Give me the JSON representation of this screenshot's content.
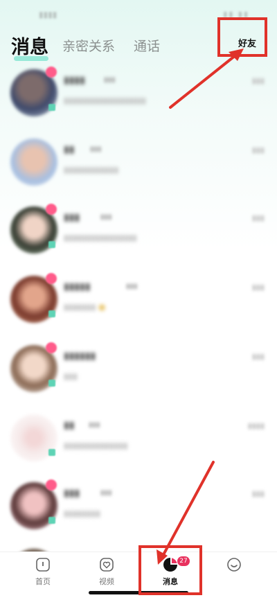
{
  "header": {
    "tabs": [
      {
        "label": "消息",
        "active": true
      },
      {
        "label": "亲密关系",
        "active": false
      },
      {
        "label": "通话",
        "active": false
      }
    ],
    "friends_label": "好友"
  },
  "bottom_nav": {
    "items": [
      {
        "label": "首页",
        "icon": "home-icon"
      },
      {
        "label": "视频",
        "icon": "heart-icon"
      },
      {
        "label": "消息",
        "icon": "message-icon",
        "badge": "27",
        "active": true
      },
      {
        "label": "",
        "icon": "profile-icon"
      }
    ]
  },
  "annotation": {
    "color": "#e0322a"
  },
  "colors": {
    "accent": "#7ce3cd",
    "badge": "#e8325e",
    "online": "#5ed3b5"
  }
}
